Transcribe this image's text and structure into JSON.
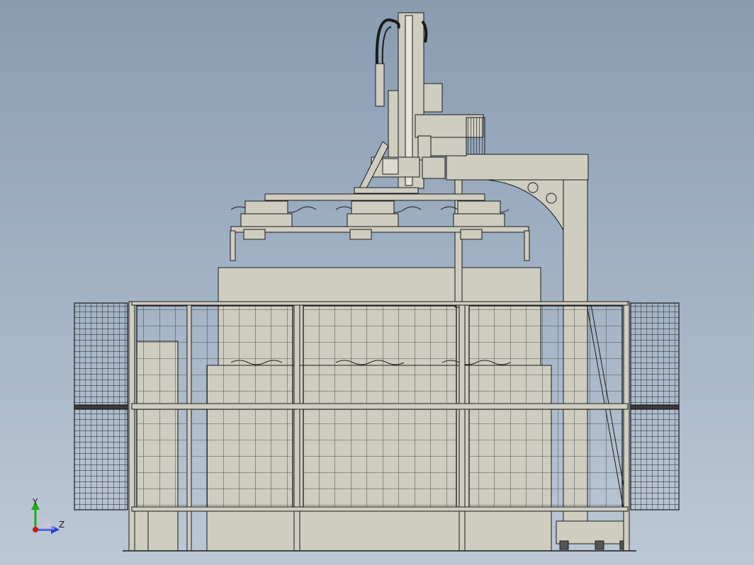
{
  "viewport": {
    "background_top": "#8a9cb2",
    "background_bottom": "#bcc8d6"
  },
  "model": {
    "fill_color": "#cfcdc0",
    "line_color": "#1a1a1a",
    "dark_fill": "#3a3a3a"
  },
  "triad": {
    "y_label": "Y",
    "z_label": "Z",
    "y_color": "#22aa22",
    "z_color": "#1f3fd8",
    "x_color": "#d01818"
  }
}
